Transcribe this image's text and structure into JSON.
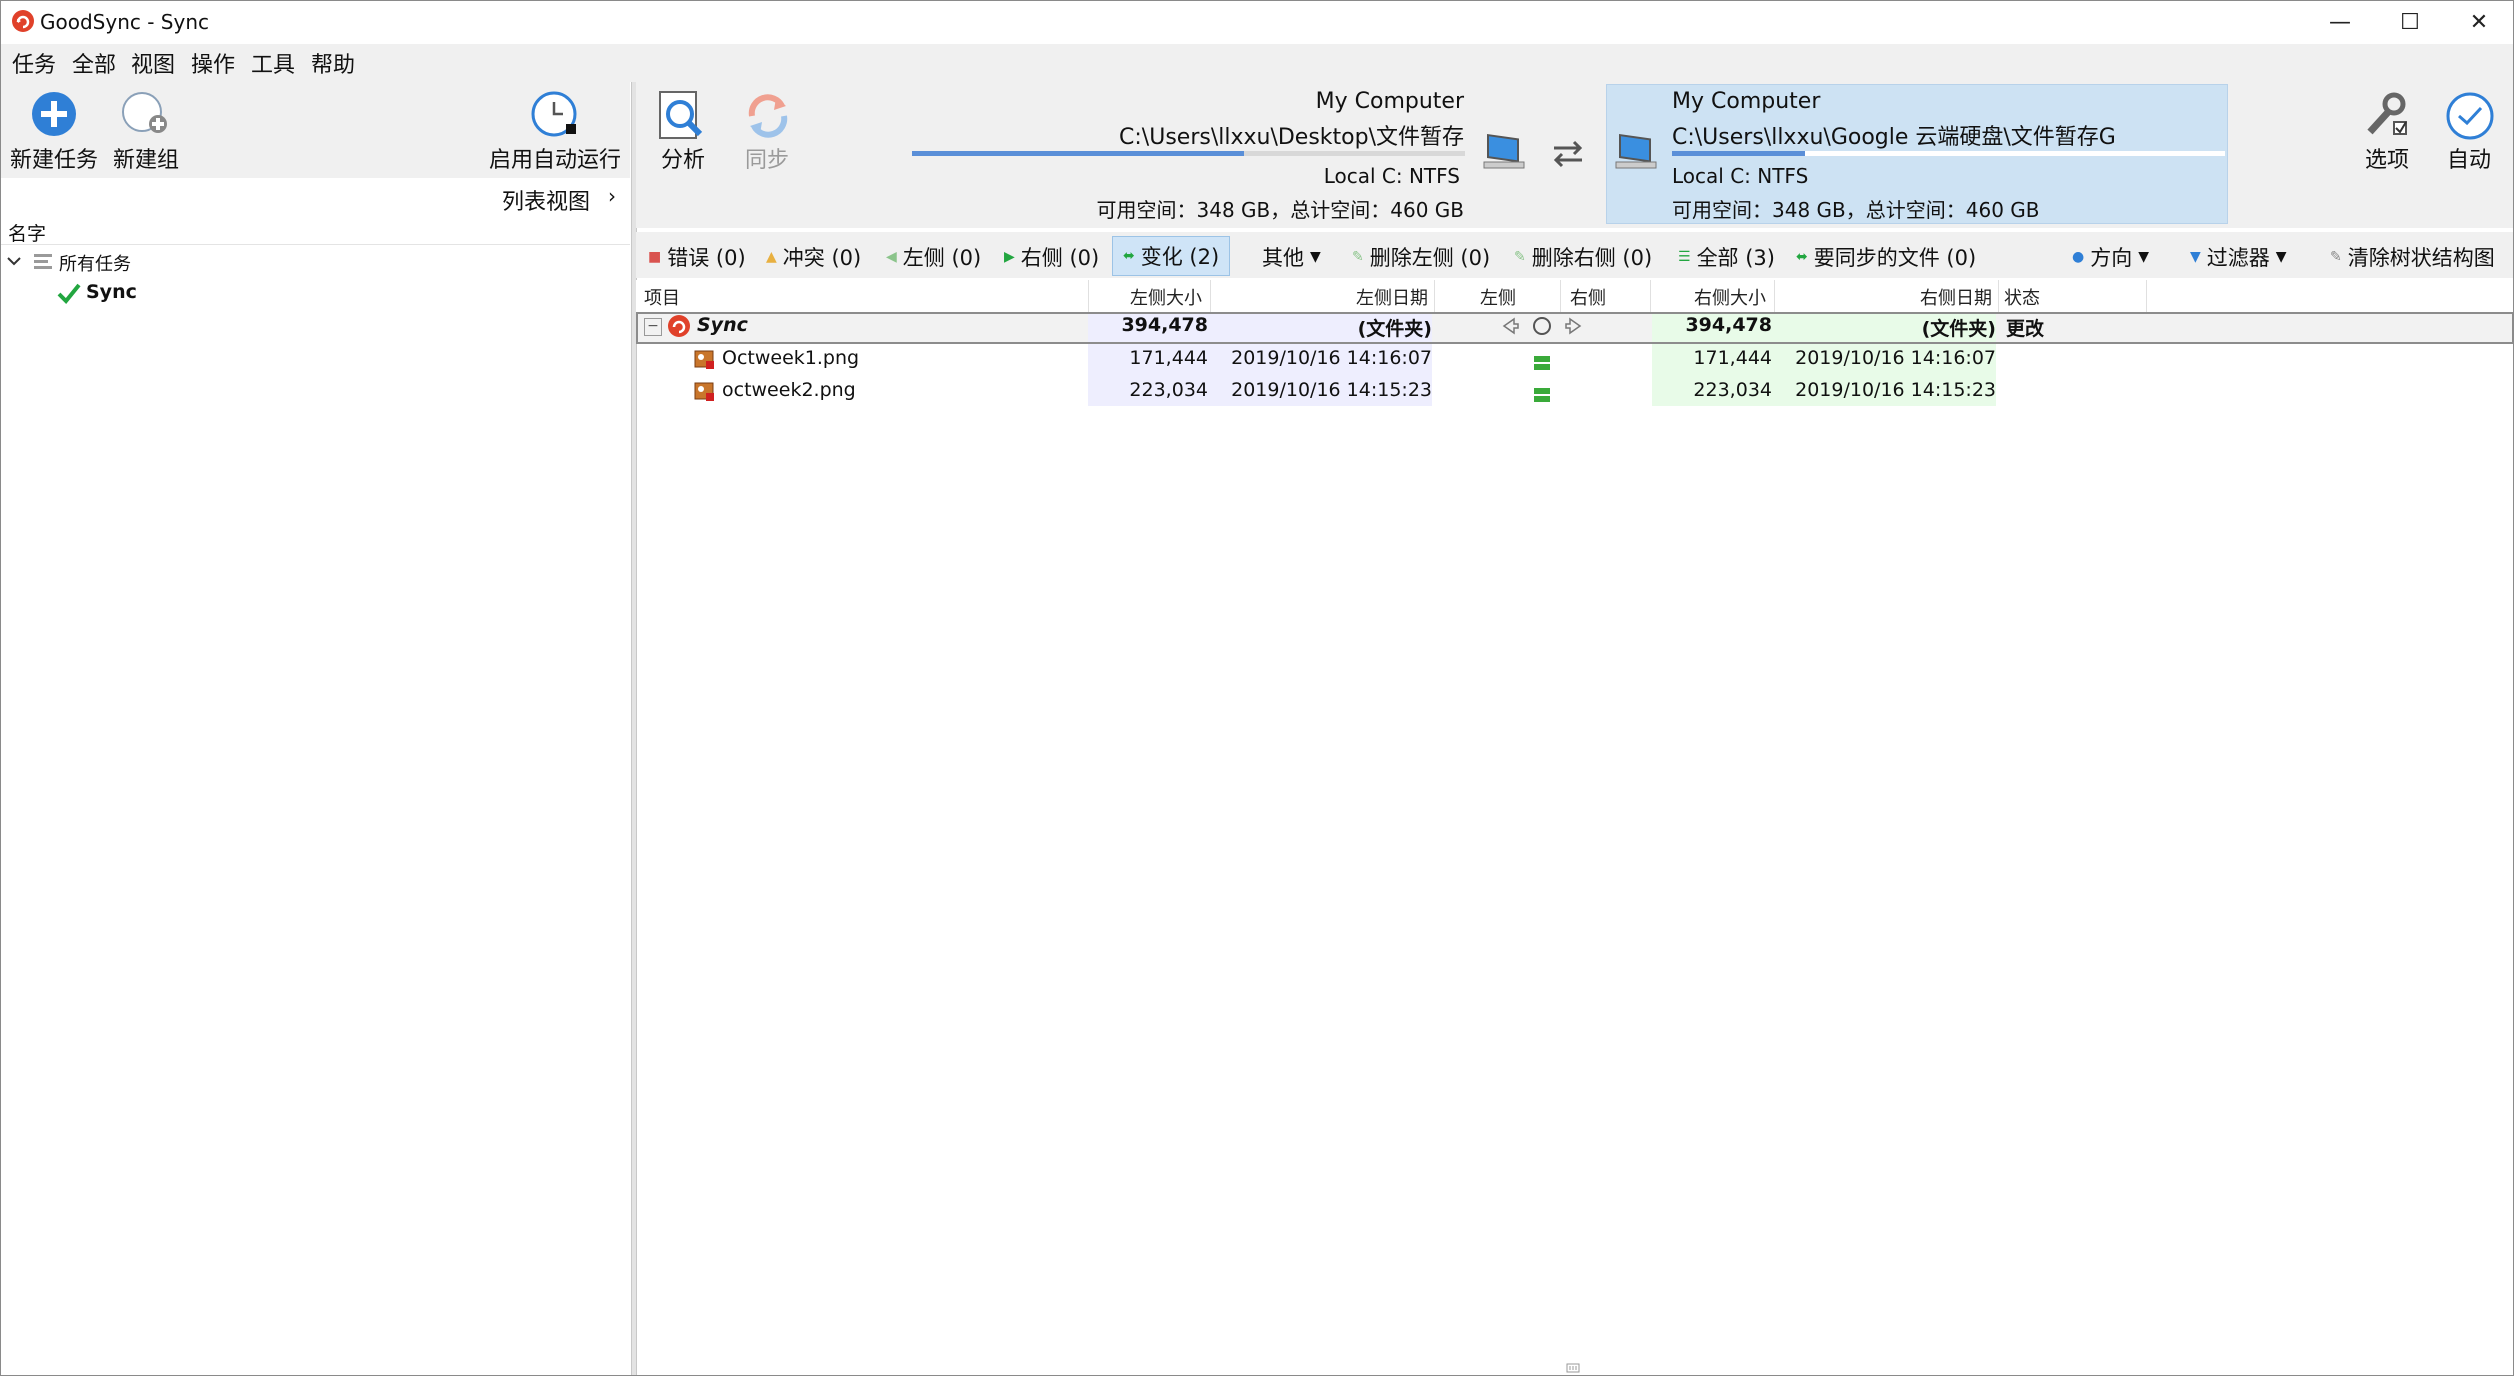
{
  "window": {
    "title": "GoodSync - Sync",
    "minimize": "—",
    "maximize": "☐",
    "close": "✕"
  },
  "menu": [
    "任务",
    "全部",
    "视图",
    "操作",
    "工具",
    "帮助"
  ],
  "left_toolbar": {
    "new_job": "新建任务",
    "new_group": "新建组",
    "auto_run": "启用自动运行"
  },
  "list_view": {
    "label": "列表视图",
    "chevron": "›"
  },
  "tree": {
    "header": "名字",
    "all_jobs": "所有任务",
    "job": "Sync"
  },
  "right_toolbar": {
    "analyze": "分析",
    "sync": "同步",
    "options": "选项",
    "auto": "自动"
  },
  "left_folder": {
    "computer": "My Computer",
    "path": "C:\\Users\\llxxu\\Desktop\\文件暂存",
    "fs": "Local C: NTFS",
    "space": "可用空间：348 GB，总计空间：460 GB",
    "progress": 0.6
  },
  "right_folder": {
    "computer": "My Computer",
    "path": "C:\\Users\\llxxu\\Google 云端硬盘\\文件暂存G",
    "fs": "Local C: NTFS",
    "space": "可用空间：348 GB，总计空间：460 GB",
    "progress": 0.24
  },
  "filters": {
    "errors": "错误 (0)",
    "conflicts": "冲突 (0)",
    "left": "左侧 (0)",
    "right": "右侧 (0)",
    "changes": "变化 (2)",
    "other": "其他",
    "delete_left": "删除左侧 (0)",
    "delete_right": "删除右侧 (0)",
    "all": "全部 (3)",
    "to_sync": "要同步的文件 (0)",
    "direction": "方向",
    "filter": "过滤器",
    "clear_tree": "清除树状结构图"
  },
  "columns": {
    "item": "项目",
    "left_size": "左侧大小",
    "left_date": "左侧日期",
    "left": "左侧",
    "right": "右侧",
    "right_size": "右侧大小",
    "right_date": "右侧日期",
    "status": "状态"
  },
  "rows": [
    {
      "name": "Sync",
      "left_size": "394,478",
      "left_date": "(文件夹)",
      "right_size": "394,478",
      "right_date": "(文件夹)",
      "status": "更改"
    },
    {
      "name": "Octweek1.png",
      "left_size": "171,444",
      "left_date": "2019/10/16 14:16:07",
      "right_size": "171,444",
      "right_date": "2019/10/16 14:16:07",
      "status": ""
    },
    {
      "name": "octweek2.png",
      "left_size": "223,034",
      "left_date": "2019/10/16 14:15:23",
      "right_size": "223,034",
      "right_date": "2019/10/16 14:15:23",
      "status": ""
    }
  ],
  "colors": {
    "accent_blue": "#2f7fd6",
    "check_green": "#22a640",
    "goodsync_red": "#e0412a",
    "selection_bg": "#cde2f3",
    "progress_blue": "#5a8fd8"
  },
  "icons": {
    "new_job": "plus-circle-icon",
    "new_group": "group-add-icon",
    "auto_run": "clock-icon",
    "analyze": "magnifier-document-icon",
    "sync": "sync-arrows-icon",
    "options": "wrench-icon",
    "auto": "clock-check-icon"
  }
}
